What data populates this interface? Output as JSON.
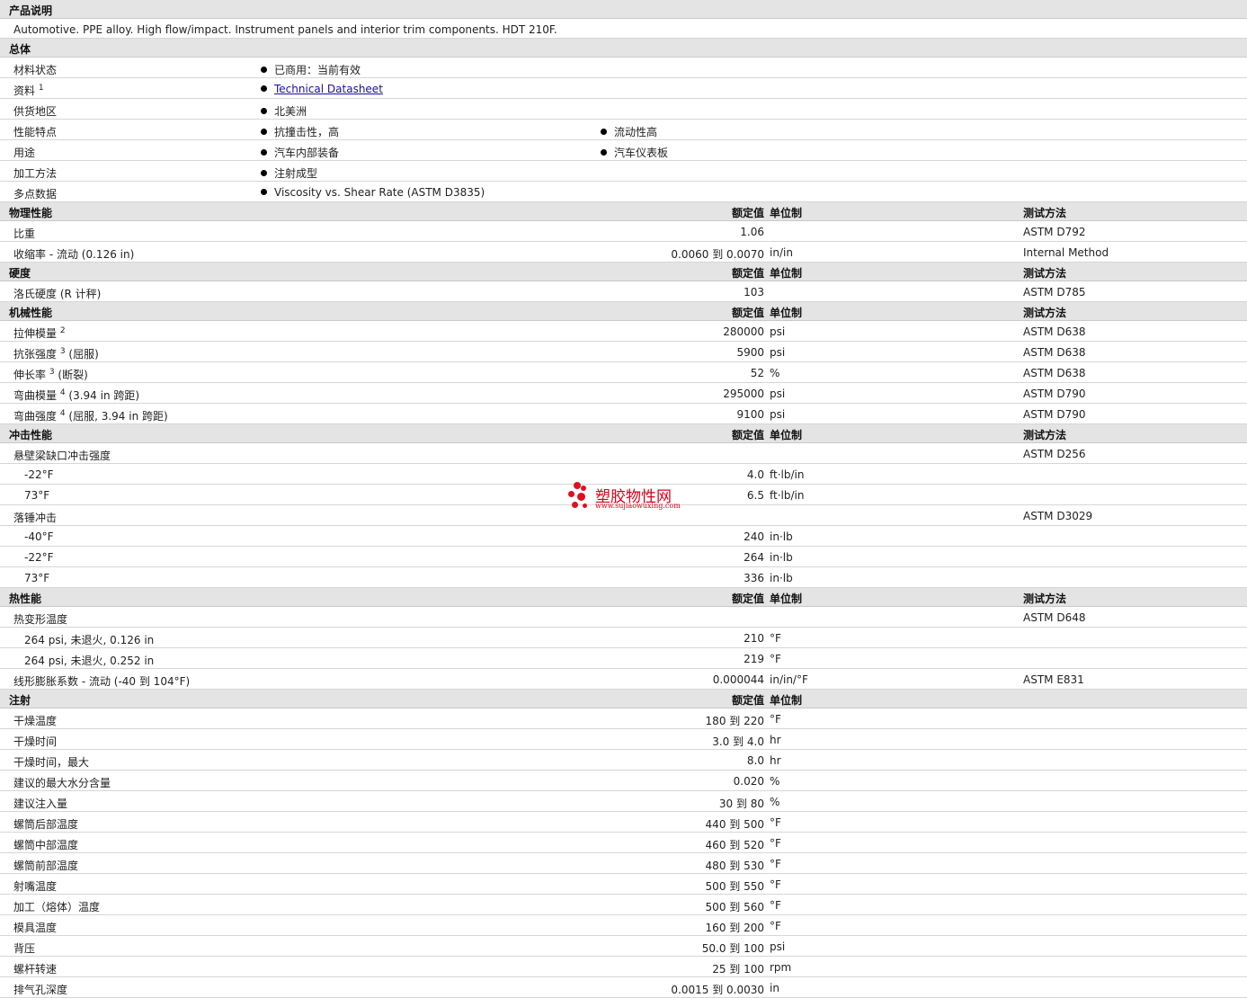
{
  "sections": {
    "desc_title": "产品说明",
    "desc_text": "Automotive. PPE alloy. High flow/impact. Instrument panels and interior trim components. HDT 210F.",
    "general": "总体",
    "physical": "物理性能",
    "hardness": "硬度",
    "mechanical": "机械性能",
    "impact": "冲击性能",
    "thermal": "热性能",
    "injection": "注射"
  },
  "col": {
    "value": "额定值",
    "unit": "单位制",
    "method": "测试方法"
  },
  "general": {
    "status_label": "材料状态",
    "status_val": "已商用：当前有效",
    "doc_label": "资料",
    "doc_sup": "1",
    "doc_link": "Technical Datasheet",
    "region_label": "供货地区",
    "region_val": "北美洲",
    "feature_label": "性能特点",
    "feature_1": "抗撞击性，高",
    "feature_2": "流动性高",
    "use_label": "用途",
    "use_1": "汽车内部装备",
    "use_2": "汽车仪表板",
    "process_label": "加工方法",
    "process_val": "注射成型",
    "multi_label": "多点数据",
    "multi_val": "Viscosity vs. Shear Rate (ASTM D3835)"
  },
  "physical": [
    {
      "label": "比重",
      "sup": "",
      "note": "",
      "value": "1.06",
      "unit": "",
      "method": "ASTM D792"
    },
    {
      "label": "收缩率 - 流动",
      "sup": "",
      "note": "(0.126 in)",
      "value": "0.0060 到  0.0070",
      "unit": "in/in",
      "method": "Internal Method"
    }
  ],
  "hardness": [
    {
      "label": "洛氏硬度",
      "sup": "",
      "note": "(R 计秤)",
      "value": "103",
      "unit": "",
      "method": "ASTM D785"
    }
  ],
  "mechanical": [
    {
      "label": "拉伸模量",
      "sup": "2",
      "note": "",
      "value": "280000",
      "unit": "psi",
      "method": "ASTM D638"
    },
    {
      "label": "抗张强度",
      "sup": "3",
      "note": "(屈服)",
      "value": "5900",
      "unit": "psi",
      "method": "ASTM D638"
    },
    {
      "label": "伸长率",
      "sup": "3",
      "note": "(断裂)",
      "value": "52",
      "unit": "%",
      "method": "ASTM D638"
    },
    {
      "label": "弯曲模量",
      "sup": "4",
      "note": "(3.94 in 跨距)",
      "value": "295000",
      "unit": "psi",
      "method": "ASTM D790"
    },
    {
      "label": "弯曲强度",
      "sup": "4",
      "note": "(屈服, 3.94 in 跨距)",
      "value": "9100",
      "unit": "psi",
      "method": "ASTM D790"
    }
  ],
  "impact": [
    {
      "label": "悬壁梁缺口冲击强度",
      "sub": false,
      "value": "",
      "unit": "",
      "method": "ASTM D256"
    },
    {
      "label": "-22°F",
      "sub": true,
      "value": "4.0",
      "unit": "ft·lb/in",
      "method": ""
    },
    {
      "label": "73°F",
      "sub": true,
      "value": "6.5",
      "unit": "ft·lb/in",
      "method": ""
    },
    {
      "label": "落锤冲击",
      "sub": false,
      "value": "",
      "unit": "",
      "method": "ASTM D3029"
    },
    {
      "label": "-40°F",
      "sub": true,
      "value": "240",
      "unit": "in·lb",
      "method": ""
    },
    {
      "label": "-22°F",
      "sub": true,
      "value": "264",
      "unit": "in·lb",
      "method": ""
    },
    {
      "label": "73°F",
      "sub": true,
      "value": "336",
      "unit": "in·lb",
      "method": ""
    }
  ],
  "thermal": [
    {
      "label": "热变形温度",
      "sub": false,
      "value": "",
      "unit": "",
      "method": "ASTM D648"
    },
    {
      "label": "264 psi, 未退火, 0.126 in",
      "sub": true,
      "value": "210",
      "unit": "°F",
      "method": ""
    },
    {
      "label": "264 psi, 未退火, 0.252 in",
      "sub": true,
      "value": "219",
      "unit": "°F",
      "method": ""
    },
    {
      "label": "线形膨胀系数 - 流动 (-40 到  104°F)",
      "sub": false,
      "value": "0.000044",
      "unit": "in/in/°F",
      "method": "ASTM E831"
    }
  ],
  "injection": [
    {
      "label": "干燥温度",
      "value": "180 到  220",
      "unit": "°F"
    },
    {
      "label": "干燥时间",
      "value": "3.0 到  4.0",
      "unit": "hr"
    },
    {
      "label": "干燥时间，最大",
      "value": "8.0",
      "unit": "hr"
    },
    {
      "label": "建议的最大水分含量",
      "value": "0.020",
      "unit": "%"
    },
    {
      "label": "建议注入量",
      "value": "30 到  80",
      "unit": "%"
    },
    {
      "label": "螺筒后部温度",
      "value": "440 到  500",
      "unit": "°F"
    },
    {
      "label": "螺筒中部温度",
      "value": "460 到  520",
      "unit": "°F"
    },
    {
      "label": "螺筒前部温度",
      "value": "480 到  530",
      "unit": "°F"
    },
    {
      "label": "射嘴温度",
      "value": "500 到  550",
      "unit": "°F"
    },
    {
      "label": "加工（熔体）温度",
      "value": "500 到  560",
      "unit": "°F"
    },
    {
      "label": "模具温度",
      "value": "160 到  200",
      "unit": "°F"
    },
    {
      "label": "背压",
      "value": "50.0 到  100",
      "unit": "psi"
    },
    {
      "label": "螺杆转速",
      "value": "25 到  100",
      "unit": "rpm"
    },
    {
      "label": "排气孔深度",
      "value": "0.0015 到  0.0030",
      "unit": "in"
    }
  ],
  "watermark": {
    "name": "塑胶物性网",
    "url": "www.sujiaowuxing.com"
  }
}
